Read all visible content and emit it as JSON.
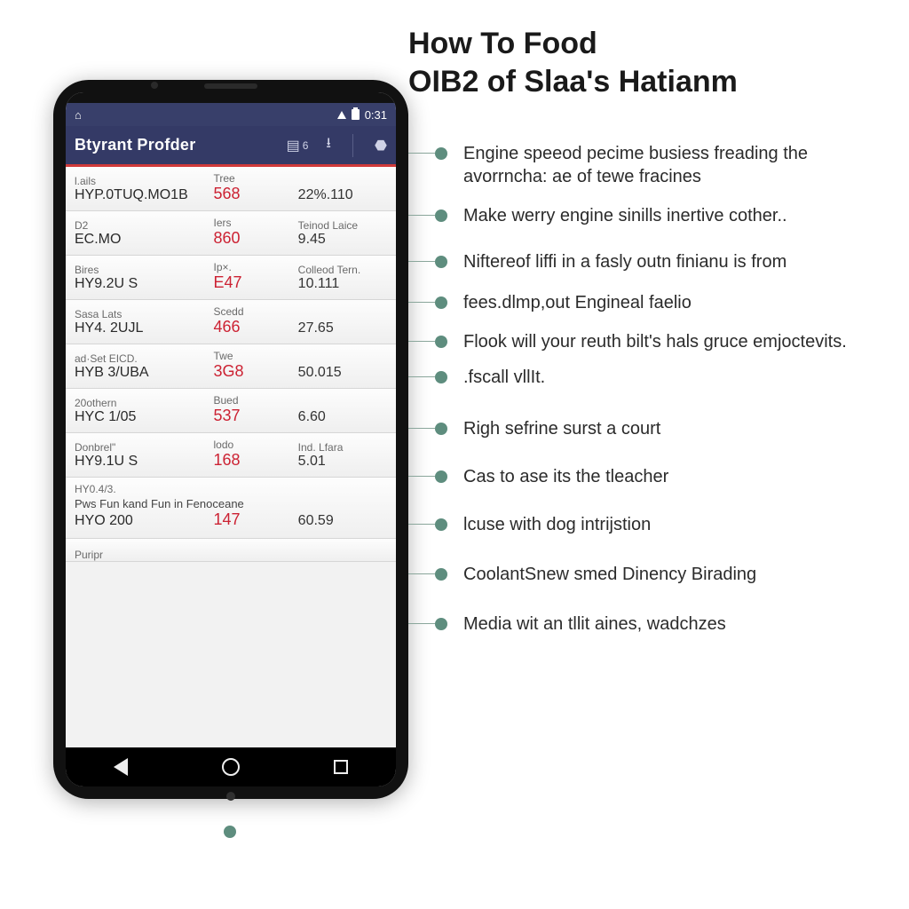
{
  "heading": {
    "line1": "How To Food",
    "line2": "OIB2 of Slaa's Hatianm"
  },
  "statusbar": {
    "time": "0:31"
  },
  "appbar": {
    "title_prefix": "Btyrant ",
    "title_bold": "Profder",
    "badge": "6"
  },
  "rows": [
    {
      "lbl": "l.ails",
      "code": "HYP.0TUQ.MO1B",
      "hdr2": "Tree",
      "val": "568",
      "hdr3": "",
      "num": "22%.110"
    },
    {
      "lbl": "D2",
      "code": "EC.MO",
      "hdr2": "Iers",
      "val": "860",
      "hdr3": "Teinod Laice",
      "num": "9.45"
    },
    {
      "lbl": "Bires",
      "code": "HY9.2U S",
      "hdr2": "Ip×.",
      "val": "E47",
      "hdr3": "Colleod Tern.",
      "num": "10.111"
    },
    {
      "lbl": "Sasa Lats",
      "code": "HY4. 2UJL",
      "hdr2": "Scedd",
      "val": "466",
      "hdr3": "",
      "num": "27.65"
    },
    {
      "lbl": "ad·Set EICD.",
      "code": "HYB 3/UBA",
      "hdr2": "Twe",
      "val": "3G8",
      "hdr3": "",
      "num": "50.015"
    },
    {
      "lbl": "20othern",
      "code": "HYC 1/05",
      "hdr2": "Bued",
      "val": "537",
      "hdr3": "",
      "num": "6.60"
    },
    {
      "lbl": "Donbrel\"",
      "code": "HY9.1U S",
      "hdr2": "lodo",
      "val": "168",
      "hdr3": "Ind. Lfara",
      "num": "5.01"
    },
    {
      "lbl": "HY0.4/3.",
      "code": "HYO 200",
      "sub": "Pws Fun kand Fun in Fenoceane",
      "hdr2": "",
      "val": "147",
      "hdr3": "",
      "num": "60.59"
    }
  ],
  "last_row_label": "Puripr",
  "annotations": [
    "Engine speeod pecime busiess freading the avorrncha: ae of tewe fracines",
    "Make werry engine sinills inertive cother..",
    "Niftereof liffi in a fasly outn finianu is from",
    "fees.dlmp,out Engineal faelio",
    "Flook will your reuth bilt's hals gruce emjoctevits.",
    ".fscall vllIt.",
    "Righ sefrine surst a court",
    "Cas to ase its the tleacher",
    "lcuse with dog intrijstion",
    "CoolantSnew smed Dinency Birading",
    "Media wit an tllit aines, wadchzes"
  ]
}
